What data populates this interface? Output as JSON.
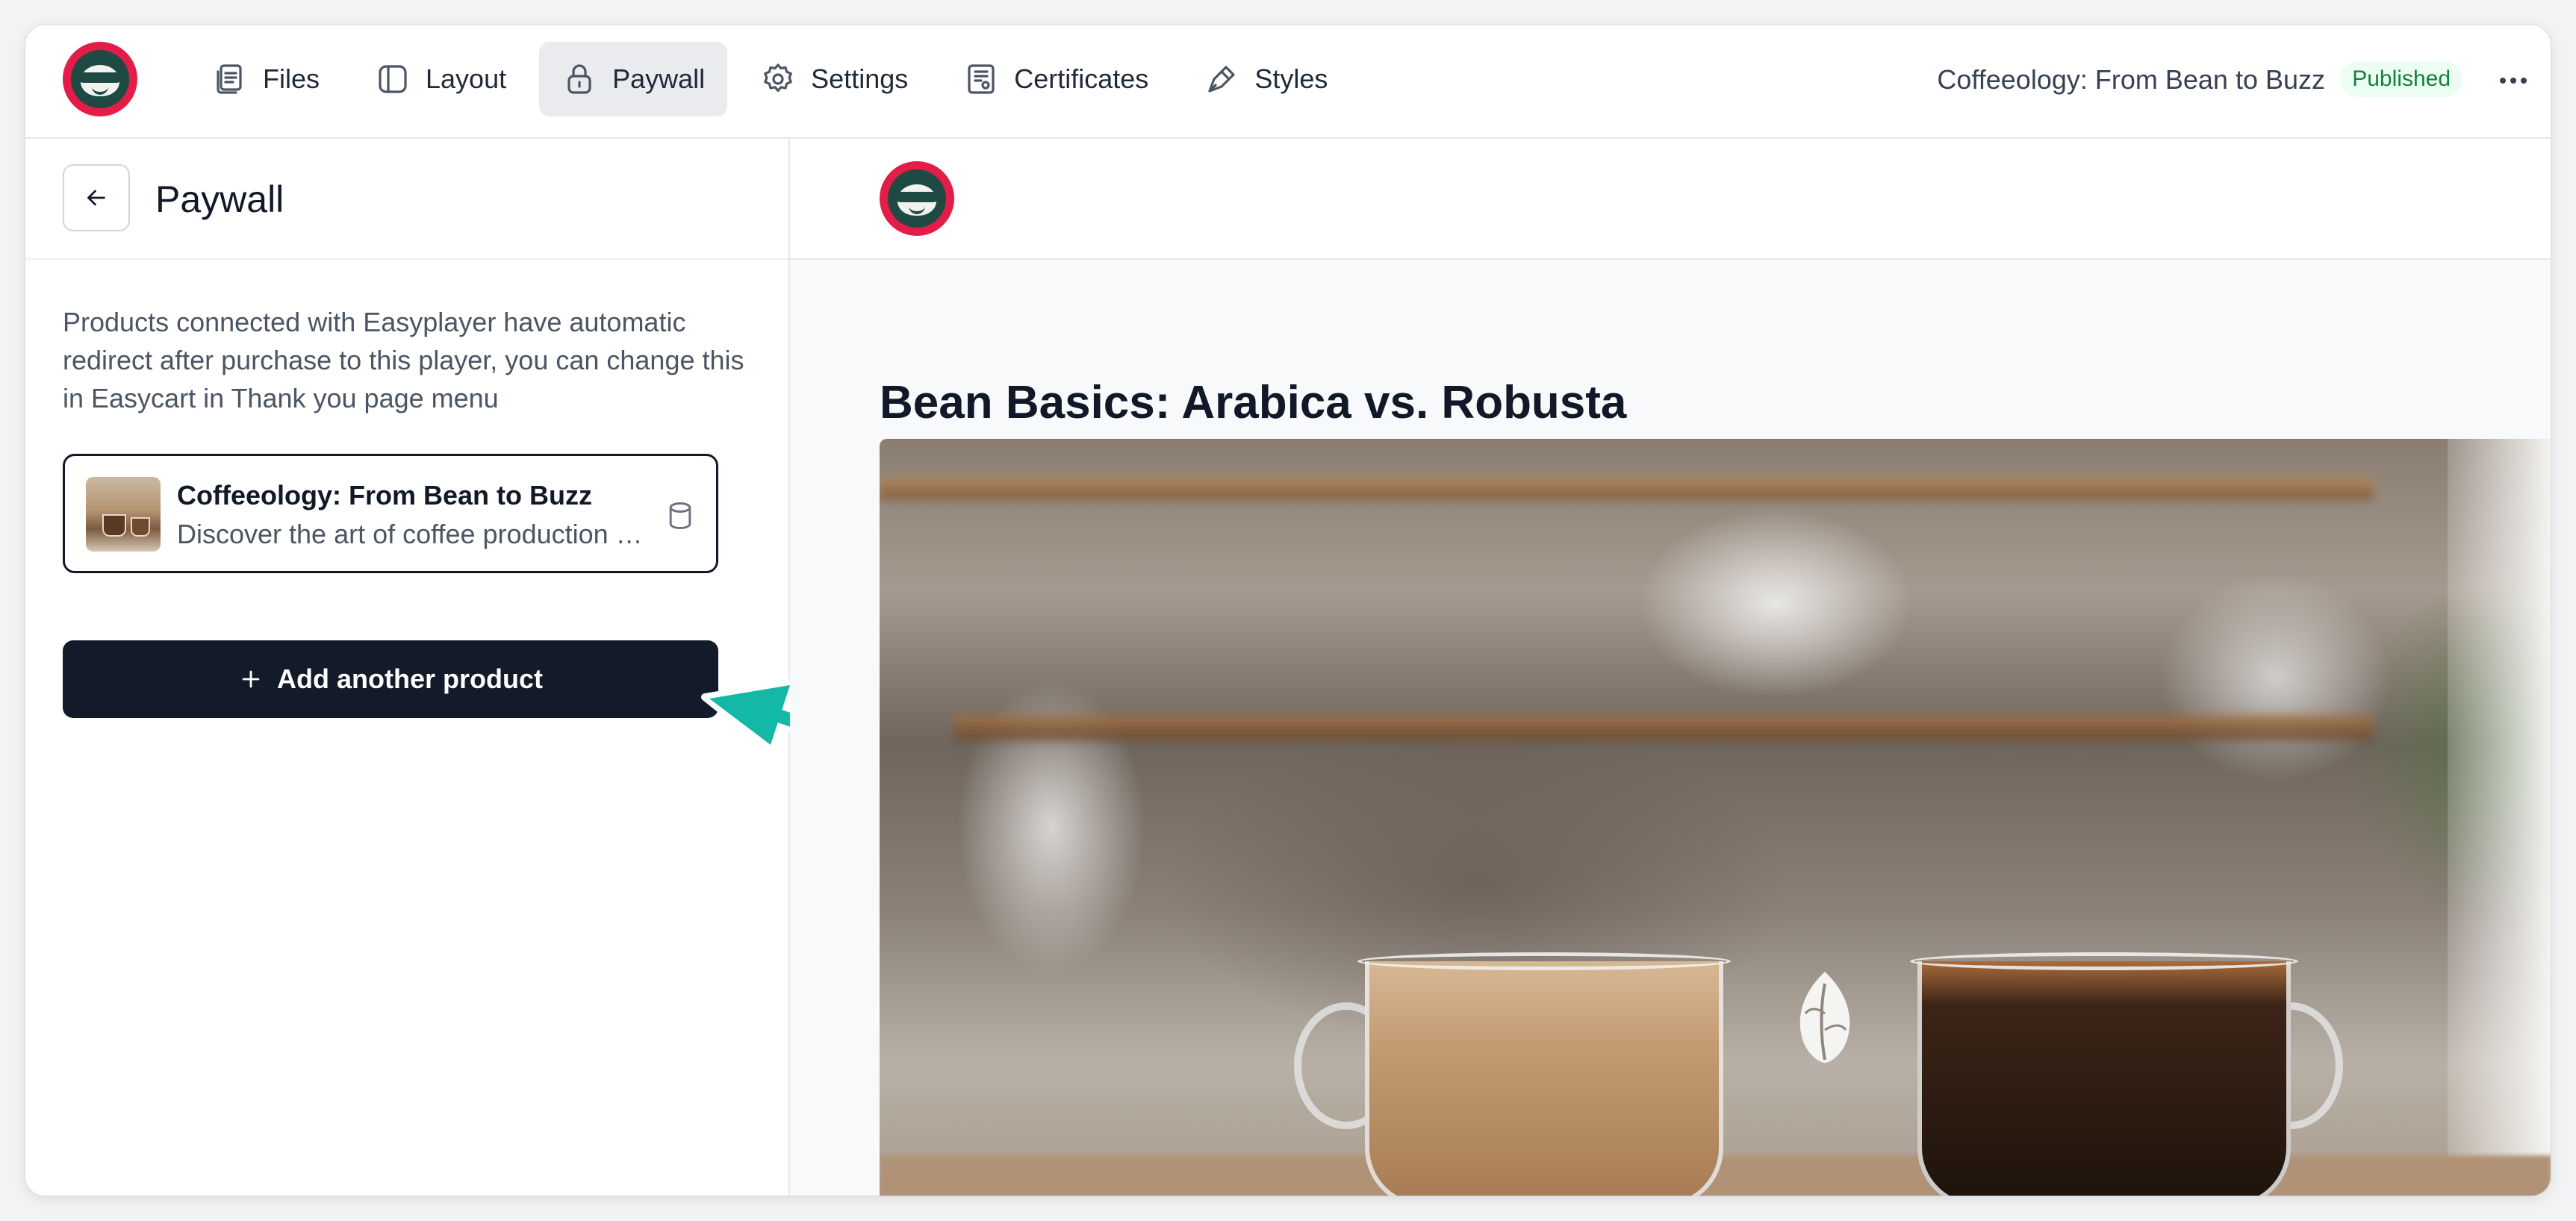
{
  "nav": {
    "items": [
      {
        "label": "Files",
        "icon": "files-icon",
        "active": false
      },
      {
        "label": "Layout",
        "icon": "layout-icon",
        "active": false
      },
      {
        "label": "Paywall",
        "icon": "lock-icon",
        "active": true
      },
      {
        "label": "Settings",
        "icon": "gear-icon",
        "active": false
      },
      {
        "label": "Certificates",
        "icon": "certificate-icon",
        "active": false
      },
      {
        "label": "Styles",
        "icon": "brush-icon",
        "active": false
      }
    ],
    "course_title": "Coffeeology: From Bean to Buzz",
    "status_badge": "Published"
  },
  "left_panel": {
    "title": "Paywall",
    "info_text": "Products connected with Easyplayer have automatic redirect after purchase to this player, you can change this in Easycart in Thank you page menu",
    "product": {
      "name": "Coffeeology: From Bean to Buzz",
      "description": "Discover the art of coffee production and brewing"
    },
    "add_button_label": "Add another product"
  },
  "preview": {
    "lesson_title": "Bean Basics: Arabica vs. Robusta"
  },
  "colors": {
    "brand": "#e11d48",
    "brand_dark": "#1f4a44",
    "primary_button": "#131a2a",
    "badge_bg": "#ecfdf3",
    "badge_text": "#15803d",
    "annotation_arrow": "#14b8a6"
  }
}
